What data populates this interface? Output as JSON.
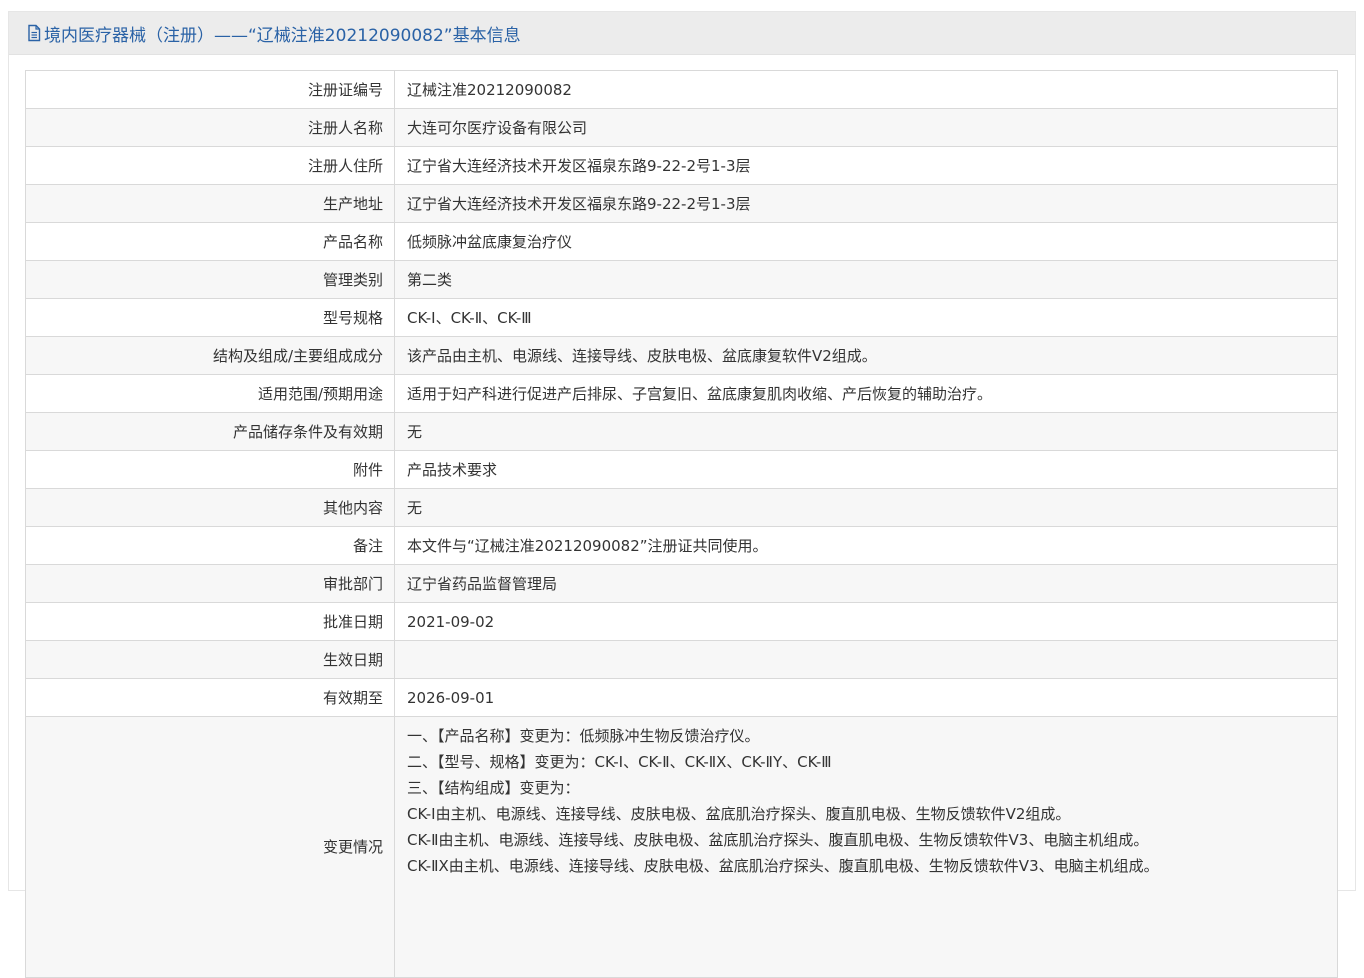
{
  "header": {
    "icon": "document-icon",
    "title": "境内医疗器械（注册）——“辽械注准20212090082”基本信息"
  },
  "rows": [
    {
      "label": "注册证编号",
      "value": "辽械注准20212090082"
    },
    {
      "label": "注册人名称",
      "value": "大连可尔医疗设备有限公司"
    },
    {
      "label": "注册人住所",
      "value": "辽宁省大连经济技术开发区福泉东路9-22-2号1-3层"
    },
    {
      "label": "生产地址",
      "value": "辽宁省大连经济技术开发区福泉东路9-22-2号1-3层"
    },
    {
      "label": "产品名称",
      "value": "低频脉冲盆底康复治疗仪"
    },
    {
      "label": "管理类别",
      "value": "第二类"
    },
    {
      "label": "型号规格",
      "value": "CK-I、CK-Ⅱ、CK-Ⅲ"
    },
    {
      "label": "结构及组成/主要组成成分",
      "value": "该产品由主机、电源线、连接导线、皮肤电极、盆底康复软件V2组成。"
    },
    {
      "label": "适用范围/预期用途",
      "value": "适用于妇产科进行促进产后排尿、子宫复旧、盆底康复肌肉收缩、产后恢复的辅助治疗。"
    },
    {
      "label": "产品储存条件及有效期",
      "value": "无"
    },
    {
      "label": "附件",
      "value": "产品技术要求"
    },
    {
      "label": "其他内容",
      "value": "无"
    },
    {
      "label": "备注",
      "value": "本文件与“辽械注准20212090082”注册证共同使用。"
    },
    {
      "label": "审批部门",
      "value": "辽宁省药品监督管理局"
    },
    {
      "label": "批准日期",
      "value": "2021-09-02"
    },
    {
      "label": "生效日期",
      "value": ""
    },
    {
      "label": "有效期至",
      "value": "2026-09-01"
    }
  ],
  "changes": {
    "label": "变更情况",
    "lines": [
      "一、【产品名称】变更为：低频脉冲生物反馈治疗仪。",
      "二、【型号、规格】变更为：CK-Ⅰ、CK-Ⅱ、CK-ⅡX、CK-ⅡY、CK-Ⅲ",
      "三、【结构组成】变更为：",
      "CK-I由主机、电源线、连接导线、皮肤电极、盆底肌治疗探头、腹直肌电极、生物反馈软件V2组成。",
      "CK-Ⅱ由主机、电源线、连接导线、皮肤电极、盆底肌治疗探头、腹直肌电极、生物反馈软件V3、电脑主机组成。",
      "CK-ⅡX由主机、电源线、连接导线、皮肤电极、盆底肌治疗探头、腹直肌电极、生物反馈软件V3、电脑主机组成。"
    ]
  }
}
